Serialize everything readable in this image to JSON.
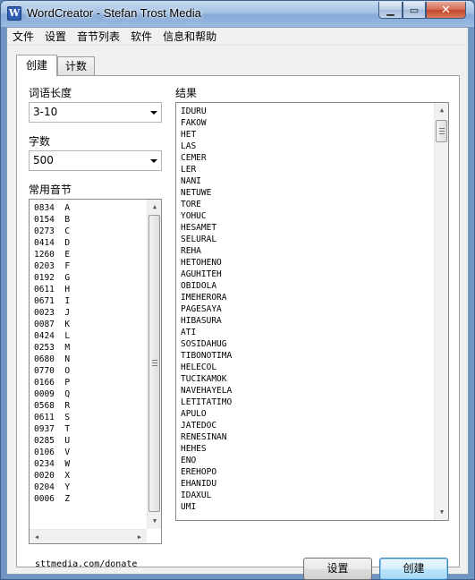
{
  "window": {
    "title": "WordCreator - Stefan Trost Media",
    "controls": {
      "minimize": "▁",
      "maximize": "▭",
      "close": "✕"
    }
  },
  "menu": [
    "文件",
    "设置",
    "音节列表",
    "软件",
    "信息和帮助"
  ],
  "tabs": [
    {
      "label": "创建",
      "active": true
    },
    {
      "label": "计数",
      "active": false
    }
  ],
  "word_length": {
    "label": "词语长度",
    "value": "3-10"
  },
  "word_count": {
    "label": "字数",
    "value": "500"
  },
  "syllables": {
    "label": "常用音节",
    "items": [
      "0834  A",
      "0154  B",
      "0273  C",
      "0414  D",
      "1260  E",
      "0203  F",
      "0192  G",
      "0611  H",
      "0671  I",
      "0023  J",
      "0087  K",
      "0424  L",
      "0253  M",
      "0680  N",
      "0770  O",
      "0166  P",
      "0009  Q",
      "0568  R",
      "0611  S",
      "0937  T",
      "0285  U",
      "0106  V",
      "0234  W",
      "0020  X",
      "0204  Y",
      "0006  Z"
    ]
  },
  "results": {
    "label": "结果",
    "items": [
      "IDURU",
      "FAKOW",
      "HET",
      "LAS",
      "CEMER",
      "LER",
      "NANI",
      "NETUWE",
      "TORE",
      "YOHUC",
      "HESAMET",
      "SELURAL",
      "REHA",
      "HETOHENO",
      "AGUHITEH",
      "OBIDOLA",
      "IMEHERORA",
      "PAGESAYA",
      "HIBASURA",
      "ATI",
      "SOSIDAHUG",
      "TIBONOTIMA",
      "HELECOL",
      "TUCIKAMOK",
      "NAVEHAYELA",
      "LETITATIMO",
      "APULO",
      "JATEDOC",
      "RENESINAN",
      "HEHES",
      "ENO",
      "EREHOPO",
      "EHANIDU",
      "IDAXUL",
      "UMI"
    ]
  },
  "footer": {
    "link": "sttmedia.com/donate",
    "settings_button": "设置",
    "create_button": "创建"
  },
  "icons": {
    "app": "W"
  }
}
